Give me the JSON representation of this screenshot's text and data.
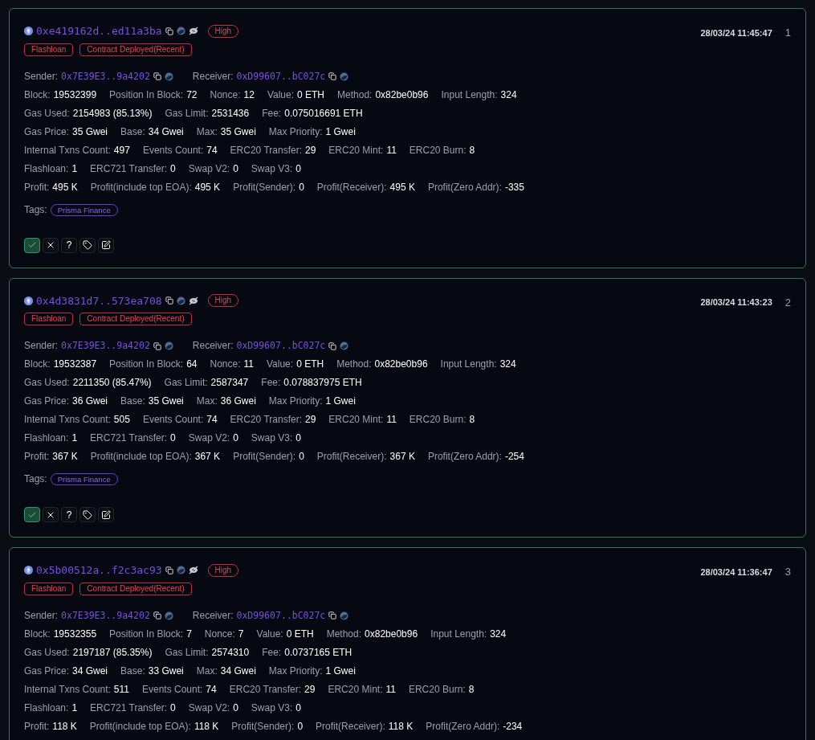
{
  "transactions": [
    {
      "hash": "0xe419162d..ed11a3ba",
      "risk": "High",
      "labels": [
        "Flashloan",
        "Contract Deployed(Recent)"
      ],
      "time": "28/03/24 11:45:47",
      "index": "1",
      "sender": {
        "label": "Sender:",
        "value": "0x7E39E3..9a4202"
      },
      "receiver": {
        "label": "Receiver:",
        "value": "0xD99607..bC027c"
      },
      "rows": [
        [
          [
            "Block:",
            "19532399"
          ],
          [
            "Position In Block:",
            "72"
          ],
          [
            "Nonce:",
            "12"
          ],
          [
            "Value:",
            "0 ETH"
          ],
          [
            "Method:",
            "0x82be0b96"
          ],
          [
            "Input Length:",
            "324"
          ]
        ],
        [
          [
            "Gas Used:",
            "2154983 (85.13%)"
          ],
          [
            "Gas Limit:",
            "2531436"
          ],
          [
            "Fee:",
            "0.075016691 ETH"
          ]
        ],
        [
          [
            "Gas Price:",
            "35 Gwei"
          ],
          [
            "Base:",
            "34 Gwei"
          ],
          [
            "Max:",
            "35 Gwei"
          ],
          [
            "Max Priority:",
            "1 Gwei"
          ]
        ],
        [
          [
            "Internal Txns Count:",
            "497"
          ],
          [
            "Events Count:",
            "74"
          ],
          [
            "ERC20 Transfer:",
            "29"
          ],
          [
            "ERC20 Mint:",
            "11"
          ],
          [
            "ERC20 Burn:",
            "8"
          ]
        ],
        [
          [
            "Flashloan:",
            "1"
          ],
          [
            "ERC721 Transfer:",
            "0"
          ],
          [
            "Swap V2:",
            "0"
          ],
          [
            "Swap V3:",
            "0"
          ]
        ],
        [
          [
            "Profit:",
            "495 K"
          ],
          [
            "Profit(include top EOA):",
            "495 K"
          ],
          [
            "Profit(Sender):",
            "0"
          ],
          [
            "Profit(Receiver):",
            "495 K"
          ],
          [
            "Profit(Zero Addr):",
            "-335"
          ]
        ]
      ],
      "tags_label": "Tags:",
      "tags": [
        "Prisma Finance"
      ],
      "actions": [
        {
          "kind": "check",
          "selected": true
        },
        {
          "kind": "cross",
          "selected": false
        },
        {
          "kind": "question",
          "label": "?",
          "selected": false
        },
        {
          "kind": "tag",
          "selected": false
        },
        {
          "kind": "edit",
          "selected": false
        }
      ]
    },
    {
      "hash": "0x4d3831d7..573ea708",
      "risk": "High",
      "labels": [
        "Flashloan",
        "Contract Deployed(Recent)"
      ],
      "time": "28/03/24 11:43:23",
      "index": "2",
      "sender": {
        "label": "Sender:",
        "value": "0x7E39E3..9a4202"
      },
      "receiver": {
        "label": "Receiver:",
        "value": "0xD99607..bC027c"
      },
      "rows": [
        [
          [
            "Block:",
            "19532387"
          ],
          [
            "Position In Block:",
            "64"
          ],
          [
            "Nonce:",
            "11"
          ],
          [
            "Value:",
            "0 ETH"
          ],
          [
            "Method:",
            "0x82be0b96"
          ],
          [
            "Input Length:",
            "324"
          ]
        ],
        [
          [
            "Gas Used:",
            "2211350 (85.47%)"
          ],
          [
            "Gas Limit:",
            "2587347"
          ],
          [
            "Fee:",
            "0.078837975 ETH"
          ]
        ],
        [
          [
            "Gas Price:",
            "36 Gwei"
          ],
          [
            "Base:",
            "35 Gwei"
          ],
          [
            "Max:",
            "36 Gwei"
          ],
          [
            "Max Priority:",
            "1 Gwei"
          ]
        ],
        [
          [
            "Internal Txns Count:",
            "505"
          ],
          [
            "Events Count:",
            "74"
          ],
          [
            "ERC20 Transfer:",
            "29"
          ],
          [
            "ERC20 Mint:",
            "11"
          ],
          [
            "ERC20 Burn:",
            "8"
          ]
        ],
        [
          [
            "Flashloan:",
            "1"
          ],
          [
            "ERC721 Transfer:",
            "0"
          ],
          [
            "Swap V2:",
            "0"
          ],
          [
            "Swap V3:",
            "0"
          ]
        ],
        [
          [
            "Profit:",
            "367 K"
          ],
          [
            "Profit(include top EOA):",
            "367 K"
          ],
          [
            "Profit(Sender):",
            "0"
          ],
          [
            "Profit(Receiver):",
            "367 K"
          ],
          [
            "Profit(Zero Addr):",
            "-254"
          ]
        ]
      ],
      "tags_label": "Tags:",
      "tags": [
        "Prisma Finance"
      ],
      "actions": [
        {
          "kind": "check",
          "selected": true
        },
        {
          "kind": "cross",
          "selected": false
        },
        {
          "kind": "question",
          "label": "?",
          "selected": false
        },
        {
          "kind": "tag",
          "selected": false
        },
        {
          "kind": "edit",
          "selected": false
        }
      ]
    },
    {
      "hash": "0x5b00512a..f2c3ac93",
      "risk": "High",
      "labels": [
        "Flashloan",
        "Contract Deployed(Recent)"
      ],
      "time": "28/03/24 11:36:47",
      "index": "3",
      "sender": {
        "label": "Sender:",
        "value": "0x7E39E3..9a4202"
      },
      "receiver": {
        "label": "Receiver:",
        "value": "0xD99607..bC027c"
      },
      "rows": [
        [
          [
            "Block:",
            "19532355"
          ],
          [
            "Position In Block:",
            "7"
          ],
          [
            "Nonce:",
            "7"
          ],
          [
            "Value:",
            "0 ETH"
          ],
          [
            "Method:",
            "0x82be0b96"
          ],
          [
            "Input Length:",
            "324"
          ]
        ],
        [
          [
            "Gas Used:",
            "2197187 (85.35%)"
          ],
          [
            "Gas Limit:",
            "2574310"
          ],
          [
            "Fee:",
            "0.0737165 ETH"
          ]
        ],
        [
          [
            "Gas Price:",
            "34 Gwei"
          ],
          [
            "Base:",
            "33 Gwei"
          ],
          [
            "Max:",
            "34 Gwei"
          ],
          [
            "Max Priority:",
            "1 Gwei"
          ]
        ],
        [
          [
            "Internal Txns Count:",
            "511"
          ],
          [
            "Events Count:",
            "74"
          ],
          [
            "ERC20 Transfer:",
            "29"
          ],
          [
            "ERC20 Mint:",
            "11"
          ],
          [
            "ERC20 Burn:",
            "8"
          ]
        ],
        [
          [
            "Flashloan:",
            "1"
          ],
          [
            "ERC721 Transfer:",
            "0"
          ],
          [
            "Swap V2:",
            "0"
          ],
          [
            "Swap V3:",
            "0"
          ]
        ],
        [
          [
            "Profit:",
            "118 K"
          ],
          [
            "Profit(include top EOA):",
            "118 K"
          ],
          [
            "Profit(Sender):",
            "0"
          ],
          [
            "Profit(Receiver):",
            "118 K"
          ],
          [
            "Profit(Zero Addr):",
            "-234"
          ]
        ]
      ]
    }
  ]
}
